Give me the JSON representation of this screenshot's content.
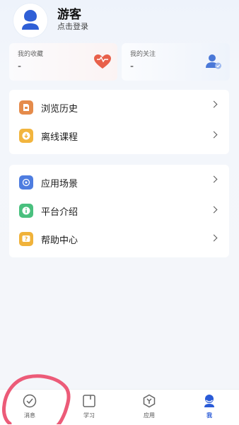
{
  "profile": {
    "username": "游客",
    "login_hint": "点击登录"
  },
  "stats": {
    "favorites": {
      "label": "我的收藏",
      "value": "-"
    },
    "following": {
      "label": "我的关注",
      "value": "-"
    }
  },
  "menu_group_1": [
    {
      "label": "浏览历史",
      "icon": "history-icon",
      "color": "#e58b4b"
    },
    {
      "label": "离线课程",
      "icon": "download-icon",
      "color": "#f2b53e"
    }
  ],
  "menu_group_2": [
    {
      "label": "应用场景",
      "icon": "scene-icon",
      "color": "#4e7de0"
    },
    {
      "label": "平台介绍",
      "icon": "info-icon",
      "color": "#49c07e"
    },
    {
      "label": "帮助中心",
      "icon": "help-icon",
      "color": "#f0b23a"
    }
  ],
  "tabbar": [
    {
      "label": "消息",
      "icon": "message-icon",
      "active": false
    },
    {
      "label": "学习",
      "icon": "study-icon",
      "active": false
    },
    {
      "label": "应用",
      "icon": "apps-icon",
      "active": false
    },
    {
      "label": "我",
      "icon": "profile-icon",
      "active": true
    }
  ],
  "colors": {
    "accent": "#2a5bd7",
    "heart": "#e8604a",
    "annotation": "#ec5b78"
  }
}
